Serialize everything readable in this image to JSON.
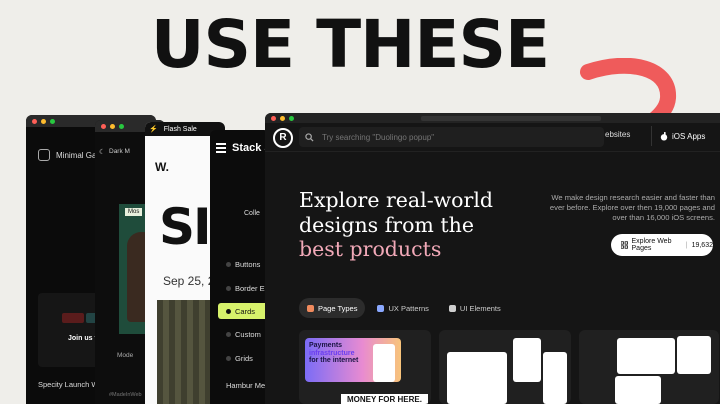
{
  "headline": "USE THESE",
  "windows": {
    "minimal": {
      "title": "Minimal Galle",
      "card_text": "Join us fr",
      "footer": "Specity Launch W"
    },
    "dark": {
      "title": "Dark M",
      "tag": "Mos",
      "mode": "Mode",
      "hashtag": "#MadeInWeb"
    },
    "sale": {
      "banner": "Flash Sale",
      "logo": "W.",
      "big_text": "SI",
      "date": "Sep 25, 2"
    },
    "stack": {
      "title": "Stack S",
      "collection": "Colle",
      "items": [
        "Buttons",
        "Border E",
        "Cards",
        "Custom",
        "Grids",
        "Hambur Menu"
      ],
      "active_index": 2
    },
    "main": {
      "logo": "R",
      "search_placeholder": "Try searching \"Duolingo popup\"",
      "nav_websites": "ebsites",
      "nav_ios": "iOS Apps",
      "hero_line1": "Explore real-world",
      "hero_line2": "designs from the",
      "hero_highlight": "best products",
      "subtitle": "We make design research easier and faster than ever before. Explore over then 19,000 pages and over than 16,000 iOS screens.",
      "cta_label": "Explore Web Pages",
      "cta_count": "19,632",
      "tabs": [
        {
          "label": "Page Types",
          "active": true,
          "color": "#f08a5d"
        },
        {
          "label": "UX Patterns",
          "active": false,
          "color": "#8aa8ff"
        },
        {
          "label": "UI Elements",
          "active": false,
          "color": "#cfcfcf"
        }
      ],
      "card1_text_a": "Payments",
      "card1_text_b": "infrastructure",
      "card1_text_c": "for the internet",
      "card1_money": "MONEY FOR HERE."
    }
  },
  "colors": {
    "arrow": "#ef5b5b",
    "accent_green": "#d7f26b",
    "hero_pink": "#f2a9b8"
  }
}
